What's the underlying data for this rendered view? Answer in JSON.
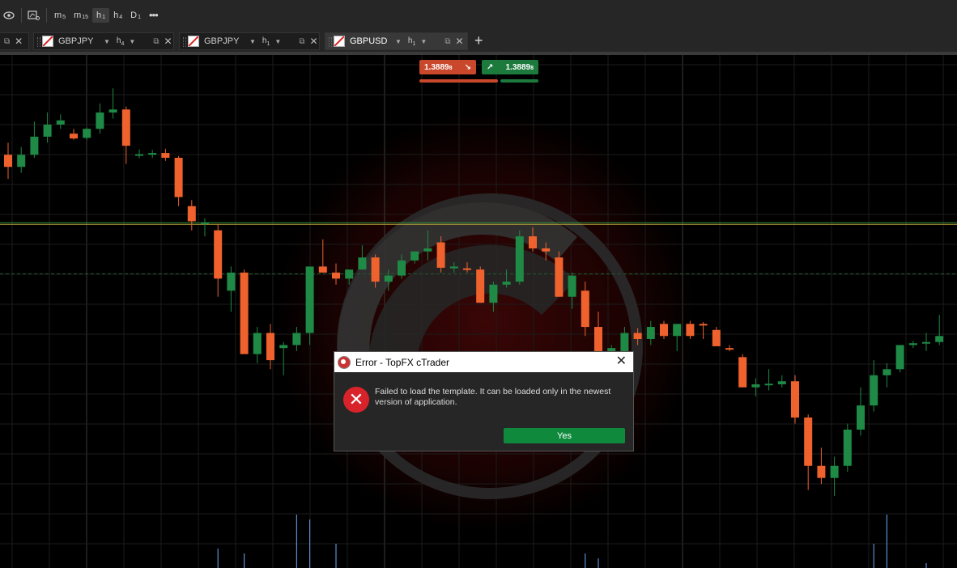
{
  "toolbar": {
    "timeframes": [
      {
        "main": "m",
        "sub": "5",
        "active": false
      },
      {
        "main": "m",
        "sub": "15",
        "active": false
      },
      {
        "main": "h",
        "sub": "1",
        "active": true
      },
      {
        "main": "h",
        "sub": "4",
        "active": false
      },
      {
        "main": "D",
        "sub": "1",
        "active": false
      }
    ],
    "more": "•••"
  },
  "tabs": [
    {
      "symbol": "GBPJPY",
      "tf_main": "h",
      "tf_sub": "4",
      "active": false
    },
    {
      "symbol": "GBPJPY",
      "tf_main": "h",
      "tf_sub": "1",
      "active": false
    },
    {
      "symbol": "GBPUSD",
      "tf_main": "h",
      "tf_sub": "1",
      "active": true
    }
  ],
  "tab_close": "✕",
  "add_tab": "+",
  "quote": {
    "sell_price": "1.3889",
    "sell_suffix": "8",
    "buy_price": "1.3889",
    "buy_suffix": "8",
    "sell_arrow": "↘",
    "buy_arrow": "↗"
  },
  "colors": {
    "bull": "#1e8a45",
    "bear": "#f0622d",
    "sell_bg": "#c9482b",
    "buy_bg": "#1c7a3d",
    "error_red": "#d9232b",
    "yes_green": "#0f8a3c"
  },
  "dialog": {
    "title": "Error - TopFX cTrader",
    "message": "Failed to load the template. It can be loaded only in the newest version of application.",
    "yes_label": "Yes",
    "close": "✕",
    "error_glyph": "✕"
  },
  "chart_data": {
    "type": "candlestick",
    "series": [
      {
        "ohlc": [
          [
            1.4005,
            1.4025,
            1.3965,
            1.3985
          ],
          [
            1.3985,
            1.4018,
            1.3975,
            1.4005
          ],
          [
            1.4005,
            1.406,
            1.4,
            1.4035
          ],
          [
            1.4035,
            1.4075,
            1.4025,
            1.4055
          ],
          [
            1.4055,
            1.4072,
            1.4048,
            1.4062
          ],
          [
            1.404,
            1.4048,
            1.403,
            1.4032
          ],
          [
            1.4033,
            1.405,
            1.403,
            1.4048
          ],
          [
            1.4048,
            1.409,
            1.404,
            1.4075
          ],
          [
            1.4075,
            1.4115,
            1.4065,
            1.408
          ],
          [
            1.408,
            1.4085,
            1.399,
            1.402
          ],
          [
            1.4006,
            1.4014,
            1.3999,
            1.4006
          ],
          [
            1.4005,
            1.4013,
            1.4,
            1.4008
          ],
          [
            1.4008,
            1.4015,
            1.3995,
            1.4
          ],
          [
            1.4,
            1.4003,
            1.392,
            1.3935
          ],
          [
            1.392,
            1.393,
            1.388,
            1.3895
          ],
          [
            1.3893,
            1.39,
            1.387,
            1.3893
          ],
          [
            1.388,
            1.389,
            1.377,
            1.38
          ],
          [
            1.378,
            1.382,
            1.3745,
            1.381
          ],
          [
            1.381,
            1.3815,
            1.368,
            1.3675
          ],
          [
            1.3675,
            1.372,
            1.366,
            1.371
          ],
          [
            1.371,
            1.3725,
            1.365,
            1.3665
          ],
          [
            1.3685,
            1.3695,
            1.364,
            1.369
          ],
          [
            1.369,
            1.372,
            1.368,
            1.371
          ],
          [
            1.371,
            1.381,
            1.369,
            1.382
          ],
          [
            1.382,
            1.3865,
            1.381,
            1.381
          ],
          [
            1.381,
            1.3825,
            1.379,
            1.38
          ],
          [
            1.38,
            1.3815,
            1.379,
            1.3815
          ],
          [
            1.3815,
            1.3855,
            1.3815,
            1.3835
          ],
          [
            1.3835,
            1.384,
            1.3785,
            1.3795
          ],
          [
            1.3795,
            1.3815,
            1.378,
            1.3805
          ],
          [
            1.3805,
            1.384,
            1.38,
            1.383
          ],
          [
            1.383,
            1.3845,
            1.3825,
            1.3845
          ],
          [
            1.3845,
            1.388,
            1.383,
            1.385
          ],
          [
            1.386,
            1.387,
            1.381,
            1.3818
          ],
          [
            1.3817,
            1.3827,
            1.381,
            1.382
          ],
          [
            1.3817,
            1.3827,
            1.381,
            1.3815
          ],
          [
            1.3815,
            1.382,
            1.376,
            1.376
          ],
          [
            1.376,
            1.3795,
            1.3745,
            1.379
          ],
          [
            1.379,
            1.3815,
            1.3785,
            1.3795
          ],
          [
            1.3795,
            1.388,
            1.379,
            1.387
          ],
          [
            1.387,
            1.3885,
            1.3845,
            1.385
          ],
          [
            1.385,
            1.386,
            1.383,
            1.3845
          ],
          [
            1.3835,
            1.3845,
            1.377,
            1.377
          ],
          [
            1.377,
            1.381,
            1.375,
            1.3805
          ],
          [
            1.378,
            1.3795,
            1.3705,
            1.372
          ],
          [
            1.372,
            1.3745,
            1.369,
            1.368
          ],
          [
            1.368,
            1.369,
            1.367,
            1.3685
          ],
          [
            1.368,
            1.372,
            1.367,
            1.371
          ],
          [
            1.371,
            1.3718,
            1.369,
            1.37
          ],
          [
            1.37,
            1.373,
            1.369,
            1.372
          ],
          [
            1.3725,
            1.373,
            1.37,
            1.3705
          ],
          [
            1.3705,
            1.3725,
            1.368,
            1.3725
          ],
          [
            1.3725,
            1.373,
            1.37,
            1.3705
          ],
          [
            1.3725,
            1.3728,
            1.37,
            1.3723
          ],
          [
            1.3715,
            1.372,
            1.369,
            1.3688
          ],
          [
            1.3685,
            1.369,
            1.368,
            1.3683
          ],
          [
            1.367,
            1.3675,
            1.362,
            1.362
          ],
          [
            1.362,
            1.3635,
            1.3605,
            1.3625
          ],
          [
            1.3626,
            1.365,
            1.3615,
            1.3626
          ],
          [
            1.3625,
            1.364,
            1.362,
            1.363
          ],
          [
            1.363,
            1.364,
            1.356,
            1.357
          ],
          [
            1.357,
            1.3575,
            1.345,
            1.349
          ],
          [
            1.349,
            1.352,
            1.346,
            1.347
          ],
          [
            1.347,
            1.3505,
            1.344,
            1.349
          ],
          [
            1.349,
            1.356,
            1.348,
            1.355
          ],
          [
            1.355,
            1.362,
            1.354,
            1.359
          ],
          [
            1.359,
            1.3665,
            1.358,
            1.364
          ],
          [
            1.364,
            1.366,
            1.362,
            1.365
          ],
          [
            1.365,
            1.369,
            1.3645,
            1.369
          ],
          [
            1.369,
            1.3697,
            1.3685,
            1.3693
          ],
          [
            1.3695,
            1.371,
            1.368,
            1.3695
          ],
          [
            1.3695,
            1.374,
            1.369,
            1.3705
          ]
        ]
      }
    ],
    "current_price": 1.38898,
    "dashed_level": 1.3808,
    "volume": [
      0,
      0,
      0,
      0,
      0,
      0,
      0,
      0,
      0,
      0,
      0,
      0,
      0,
      0,
      0,
      0,
      20,
      0,
      15,
      0,
      0,
      0,
      55,
      50,
      0,
      25,
      0,
      0,
      0,
      0,
      0,
      0,
      0,
      0,
      0,
      0,
      0,
      0,
      0,
      0,
      0,
      0,
      0,
      0,
      15,
      10,
      0,
      0,
      0,
      0,
      0,
      0,
      0,
      0,
      0,
      0,
      0,
      0,
      0,
      0,
      0,
      0,
      0,
      0,
      0,
      0,
      25,
      55,
      0,
      0,
      5,
      0
    ]
  }
}
